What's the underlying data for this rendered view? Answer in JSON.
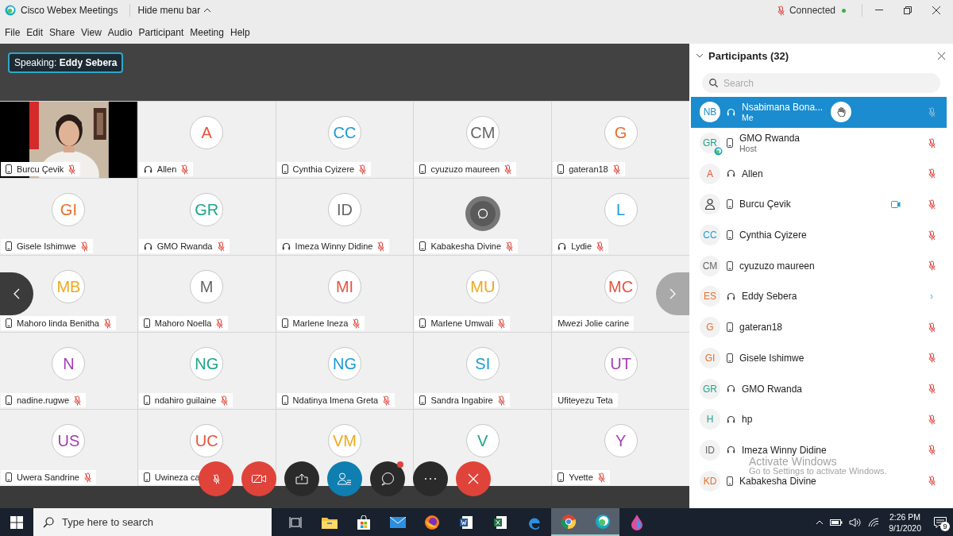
{
  "window": {
    "title": "Cisco Webex Meetings",
    "menu_toggle": "Hide menu bar",
    "status": "Connected",
    "status_muted": true
  },
  "menu": [
    "File",
    "Edit",
    "Share",
    "View",
    "Audio",
    "Participant",
    "Meeting",
    "Help"
  ],
  "speaking": {
    "label": "Speaking:",
    "name": "Eddy Sebera"
  },
  "tiles": [
    {
      "kind": "video",
      "name": "Burcu Çevik",
      "audio": {
        "kind": "phone"
      },
      "muted": true
    },
    {
      "kind": "avatar",
      "initials": "A",
      "color": "#e5553e",
      "name": "Allen",
      "audio": {
        "kind": "headset"
      },
      "muted": true
    },
    {
      "kind": "avatar",
      "initials": "CC",
      "color": "#1d9ad6",
      "name": "Cynthia Cyizere",
      "audio": {
        "kind": "phone"
      },
      "muted": true
    },
    {
      "kind": "avatar",
      "initials": "CM",
      "color": "#666666",
      "name": "cyuzuzo maureen",
      "audio": {
        "kind": "phone"
      },
      "muted": true
    },
    {
      "kind": "avatar",
      "initials": "G",
      "color": "#e8702a",
      "name": "gateran18",
      "audio": {
        "kind": "phone"
      },
      "muted": true
    },
    {
      "kind": "avatar",
      "initials": "GI",
      "color": "#e8702a",
      "name": "Gisele Ishimwe",
      "audio": {
        "kind": "phone"
      },
      "muted": true
    },
    {
      "kind": "avatar",
      "initials": "GR",
      "color": "#1fa589",
      "name": "GMO Rwanda",
      "audio": {
        "kind": "headset"
      },
      "muted": true
    },
    {
      "kind": "avatar",
      "initials": "ID",
      "color": "#666666",
      "name": "Imeza Winny Didine",
      "audio": {
        "kind": "headset"
      },
      "muted": true
    },
    {
      "kind": "chat",
      "name": "Kabakesha Divine",
      "audio": {
        "kind": "phone"
      },
      "muted": true
    },
    {
      "kind": "avatar",
      "initials": "L",
      "color": "#1d9ad6",
      "name": "Lydie",
      "audio": {
        "kind": "headset"
      },
      "muted": true
    },
    {
      "kind": "avatar",
      "initials": "MB",
      "color": "#f0a81c",
      "name": "Mahoro linda Benitha",
      "audio": {
        "kind": "phone"
      },
      "muted": true
    },
    {
      "kind": "avatar",
      "initials": "M",
      "color": "#666666",
      "name": "Mahoro Noella",
      "audio": {
        "kind": "phone"
      },
      "muted": true
    },
    {
      "kind": "avatar",
      "initials": "MI",
      "color": "#e5553e",
      "name": "Marlene Ineza",
      "audio": {
        "kind": "phone"
      },
      "muted": true
    },
    {
      "kind": "avatar",
      "initials": "MU",
      "color": "#f0a81c",
      "name": "Marlene Umwali",
      "audio": {
        "kind": "phone"
      },
      "muted": true
    },
    {
      "kind": "avatar",
      "initials": "MC",
      "color": "#e5553e",
      "name": "Mwezi Jolie carine",
      "muted": false
    },
    {
      "kind": "avatar",
      "initials": "N",
      "color": "#a43db5",
      "name": "nadine.rugwe",
      "audio": {
        "kind": "phone"
      },
      "muted": true
    },
    {
      "kind": "avatar",
      "initials": "NG",
      "color": "#1fa589",
      "name": "ndahiro guilaine",
      "audio": {
        "kind": "phone"
      },
      "muted": true
    },
    {
      "kind": "avatar",
      "initials": "NG",
      "color": "#1d9ad6",
      "name": "Ndatinya Imena Greta",
      "audio": {
        "kind": "phone"
      },
      "muted": true
    },
    {
      "kind": "avatar",
      "initials": "SI",
      "color": "#1d9ad6",
      "name": "Sandra Ingabire",
      "audio": {
        "kind": "phone"
      },
      "muted": true
    },
    {
      "kind": "avatar",
      "initials": "UT",
      "color": "#a43db5",
      "name": "Ufiteyezu Teta",
      "muted": false
    },
    {
      "kind": "avatar",
      "initials": "US",
      "color": "#a43db5",
      "name": "Uwera Sandrine",
      "audio": {
        "kind": "phone"
      },
      "muted": true
    },
    {
      "kind": "avatar",
      "initials": "UC",
      "color": "#e5553e",
      "name": "Uwineza ca",
      "audio": {
        "kind": "phone"
      },
      "muted": false
    },
    {
      "kind": "avatar",
      "initials": "VM",
      "color": "#f0a81c"
    },
    {
      "kind": "avatar",
      "initials": "V",
      "color": "#1fa589"
    },
    {
      "kind": "avatar",
      "initials": "Y",
      "color": "#a43db5",
      "name": "Yvette",
      "audio": {
        "kind": "phone"
      },
      "muted": true
    }
  ],
  "toolbar": {
    "chat_unread": true
  },
  "participants": {
    "title": "Participants (32)",
    "expanded": true,
    "search": {
      "placeholder": "Search"
    },
    "items": [
      {
        "kind": "initials",
        "initials": "NB",
        "color": "#1a8ccf",
        "name": "Nsabimana Bona...",
        "role": "Me",
        "audio": {
          "kind": "headset"
        },
        "muted": true,
        "selected": true,
        "hand_raised": true,
        "video": false,
        "speaking": false,
        "presenter": false
      },
      {
        "kind": "initials",
        "initials": "GR",
        "color": "#1fa589",
        "name": "GMO Rwanda",
        "role": "Host",
        "audio": {
          "kind": "phone"
        },
        "muted": true,
        "selected": false,
        "hand_raised": false,
        "video": false,
        "speaking": false,
        "presenter": true
      },
      {
        "kind": "initials",
        "initials": "A",
        "color": "#e5553e",
        "name": "Allen",
        "audio": {
          "kind": "headset"
        },
        "muted": true,
        "selected": false,
        "hand_raised": false,
        "video": false,
        "speaking": false,
        "presenter": false
      },
      {
        "kind": "person",
        "name": "Burcu Çevik",
        "audio": {
          "kind": "phone"
        },
        "muted": true,
        "selected": false,
        "hand_raised": false,
        "video": true,
        "speaking": false,
        "presenter": false
      },
      {
        "kind": "initials",
        "initials": "CC",
        "color": "#1d9ad6",
        "name": "Cynthia Cyizere",
        "audio": {
          "kind": "phone"
        },
        "muted": true,
        "selected": false,
        "hand_raised": false,
        "video": false,
        "speaking": false,
        "presenter": false
      },
      {
        "kind": "initials",
        "initials": "CM",
        "color": "#666666",
        "name": "cyuzuzo maureen",
        "audio": {
          "kind": "phone"
        },
        "muted": true,
        "selected": false,
        "hand_raised": false,
        "video": false,
        "speaking": false,
        "presenter": false
      },
      {
        "kind": "initials",
        "initials": "ES",
        "color": "#e8702a",
        "name": "Eddy Sebera",
        "audio": {
          "kind": "headset"
        },
        "muted": false,
        "selected": false,
        "hand_raised": false,
        "video": false,
        "speaking": true,
        "presenter": false
      },
      {
        "kind": "initials",
        "initials": "G",
        "color": "#e8702a",
        "name": "gateran18",
        "audio": {
          "kind": "phone"
        },
        "muted": true,
        "selected": false,
        "hand_raised": false,
        "video": false,
        "speaking": false,
        "presenter": false
      },
      {
        "kind": "initials",
        "initials": "GI",
        "color": "#e8702a",
        "name": "Gisele Ishimwe",
        "audio": {
          "kind": "phone"
        },
        "muted": true,
        "selected": false,
        "hand_raised": false,
        "video": false,
        "speaking": false,
        "presenter": false
      },
      {
        "kind": "initials",
        "initials": "GR",
        "color": "#1fa589",
        "name": "GMO Rwanda",
        "audio": {
          "kind": "headset"
        },
        "muted": true,
        "selected": false,
        "hand_raised": false,
        "video": false,
        "speaking": false,
        "presenter": false
      },
      {
        "kind": "initials",
        "initials": "H",
        "color": "#1fa589",
        "name": "hp",
        "audio": {
          "kind": "headset"
        },
        "muted": true,
        "selected": false,
        "hand_raised": false,
        "video": false,
        "speaking": false,
        "presenter": false
      },
      {
        "kind": "initials",
        "initials": "ID",
        "color": "#666666",
        "name": "Imeza Winny Didine",
        "audio": {
          "kind": "headset"
        },
        "muted": true,
        "selected": false,
        "hand_raised": false,
        "video": false,
        "speaking": false,
        "presenter": false
      },
      {
        "kind": "initials",
        "initials": "KD",
        "color": "#e8702a",
        "name": "Kabakesha Divine",
        "audio": {
          "kind": "phone"
        },
        "muted": true,
        "selected": false,
        "hand_raised": false,
        "video": false,
        "speaking": false,
        "presenter": false
      }
    ]
  },
  "activation_notice": {
    "title": "Activate Windows",
    "text": "Go to Settings to activate Windows."
  },
  "taskbar": {
    "search": {
      "placeholder": "Type here to search"
    },
    "time": "2:26 PM",
    "date": "9/1/2020",
    "notifications": "9",
    "apps": [
      {
        "kind": "taskview",
        "active": false
      },
      {
        "kind": "explorer",
        "active": false
      },
      {
        "kind": "store",
        "active": false
      },
      {
        "kind": "mail",
        "active": false
      },
      {
        "kind": "firefox",
        "active": false
      },
      {
        "kind": "word",
        "active": false
      },
      {
        "kind": "excel",
        "active": false
      },
      {
        "kind": "edge",
        "active": false
      },
      {
        "kind": "chrome",
        "active": true
      },
      {
        "kind": "webex",
        "active": true
      },
      {
        "kind": "paint",
        "active": false
      }
    ]
  }
}
